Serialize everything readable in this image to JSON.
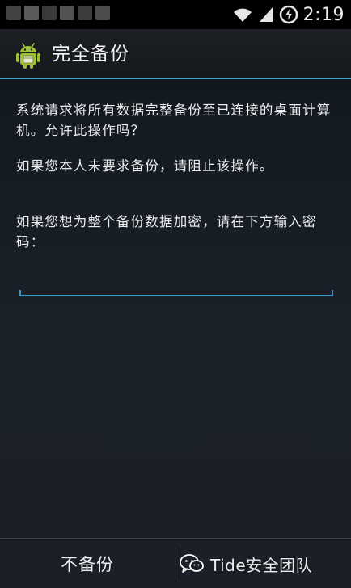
{
  "status_bar": {
    "time": "2:19"
  },
  "dialog": {
    "title": "完全备份",
    "message_1": "系统请求将所有数据完整备份至已连接的桌面计算机。允许此操作吗？",
    "message_2": "如果您本人未要求备份，请阻止该操作。",
    "message_3": "如果您想为整个备份数据加密，请在下方输入密码：",
    "password_value": "",
    "no_backup_label": "不备份"
  },
  "watermark": {
    "text": "Tide安全团队"
  },
  "colors": {
    "accent": "#2aa8da",
    "input_line": "#3c94c0",
    "android_green": "#9fc335",
    "background": "#1b2028"
  },
  "icons": {
    "wifi": "wifi-icon",
    "signal": "signal-icon",
    "battery": "battery-charging-icon",
    "app": "android-backup-icon",
    "watermark": "wechat-icon"
  }
}
